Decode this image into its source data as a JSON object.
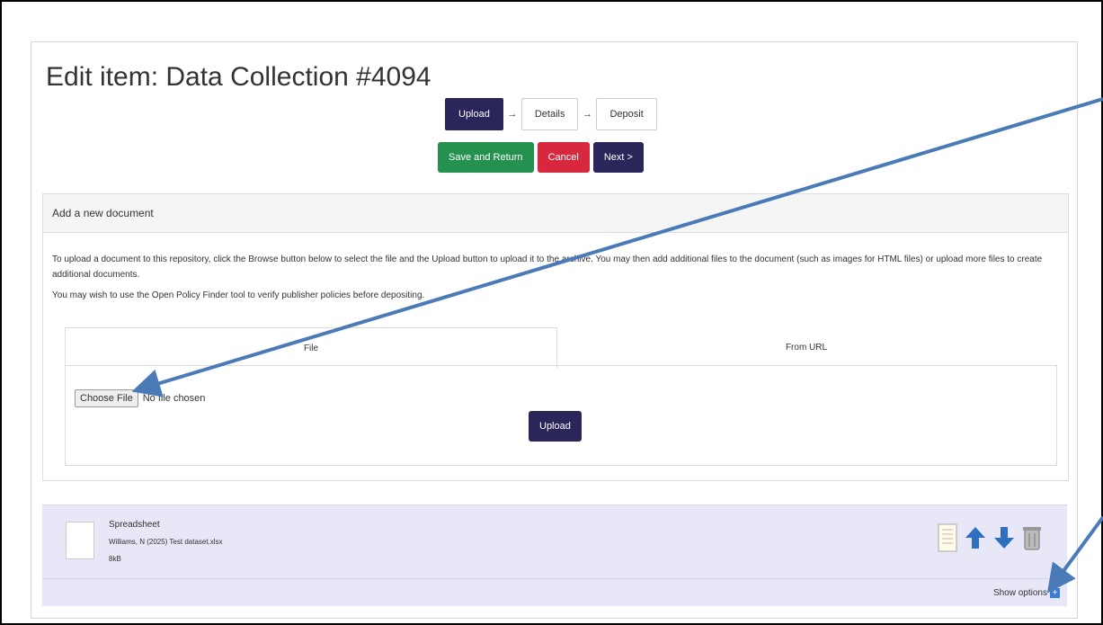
{
  "page": {
    "title": "Edit item: Data Collection #4094"
  },
  "steps": [
    "Upload",
    "Details",
    "Deposit"
  ],
  "step_arrow": "→",
  "actions": {
    "save_return": "Save and Return",
    "cancel": "Cancel",
    "next": "Next >"
  },
  "panel": {
    "heading": "Add a new document",
    "para1": "To upload a document to this repository, click the Browse button below to select the file and the Upload button to upload it to the archive. You may then add additional files to the document (such as images for HTML files) or upload more files to create additional documents.",
    "para2": "You may wish to use the Open Policy Finder tool to verify publisher policies before depositing."
  },
  "tabs": {
    "file": "File",
    "url": "From URL"
  },
  "file_input": {
    "button": "Choose File",
    "status": "No file chosen"
  },
  "upload_button": "Upload",
  "document": {
    "type": "Spreadsheet",
    "name": "Williams, N (2025) Test dataset.xlsx",
    "size": "8kB"
  },
  "show_options": "Show options",
  "colors": {
    "navy": "#2b2659",
    "green": "#25914f",
    "red": "#d8283f",
    "annotation": "#4a7ab8"
  },
  "icons": [
    "document-icon",
    "view-icon",
    "move-up-icon",
    "move-down-icon",
    "delete-icon",
    "plus-icon"
  ]
}
